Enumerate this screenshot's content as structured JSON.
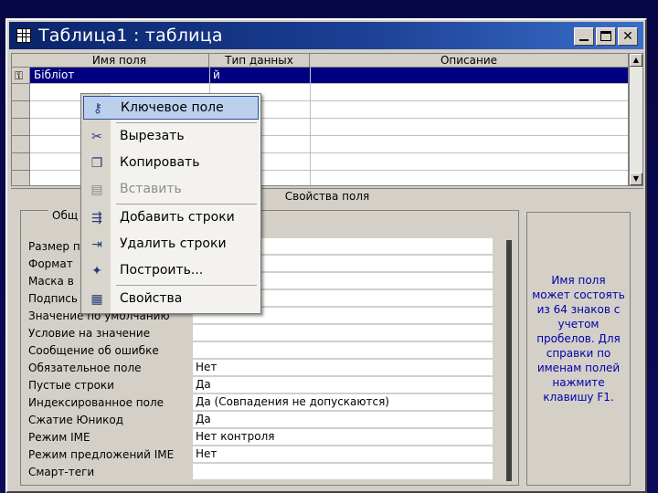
{
  "window": {
    "title": "Таблица1 : таблица"
  },
  "grid": {
    "columns": [
      "Имя поля",
      "Тип данных",
      "Описание"
    ],
    "first_row_name": "Бібліот",
    "first_row_type": "й"
  },
  "context_menu": {
    "items": [
      {
        "label": "Ключевое поле",
        "icon": "key-icon",
        "disabled": false
      },
      {
        "label": "Вырезать",
        "icon": "scissors-icon",
        "disabled": false
      },
      {
        "label": "Копировать",
        "icon": "copy-icon",
        "disabled": false
      },
      {
        "label": "Вставить",
        "icon": "paste-icon",
        "disabled": true
      },
      {
        "label": "Добавить строки",
        "icon": "insert-rows-icon",
        "disabled": false
      },
      {
        "label": "Удалить строки",
        "icon": "delete-rows-icon",
        "disabled": false
      },
      {
        "label": "Построить...",
        "icon": "build-wand-icon",
        "disabled": false
      },
      {
        "label": "Свойства",
        "icon": "properties-icon",
        "disabled": false
      }
    ]
  },
  "properties": {
    "title": "Свойства поля",
    "tab": "Общ",
    "rows": [
      {
        "label": "Размер п",
        "value": ""
      },
      {
        "label": "Формат",
        "value": ""
      },
      {
        "label": "Маска в",
        "value": ""
      },
      {
        "label": "Подпись",
        "value": ""
      },
      {
        "label": "Значение по умолчанию",
        "value": ""
      },
      {
        "label": "Условие на значение",
        "value": ""
      },
      {
        "label": "Сообщение об ошибке",
        "value": ""
      },
      {
        "label": "Обязательное поле",
        "value": "Нет"
      },
      {
        "label": "Пустые строки",
        "value": "Да"
      },
      {
        "label": "Индексированное поле",
        "value": "Да (Совпадения не допускаются)"
      },
      {
        "label": "Сжатие Юникод",
        "value": "Да"
      },
      {
        "label": "Режим IME",
        "value": "Нет контроля"
      },
      {
        "label": "Режим предложений IME",
        "value": "Нет"
      },
      {
        "label": "Смарт-теги",
        "value": ""
      }
    ]
  },
  "help": {
    "text": "Имя поля может состоять из 64 знаков с учетом пробелов. Для справки по именам полей нажмите клавишу F1."
  }
}
